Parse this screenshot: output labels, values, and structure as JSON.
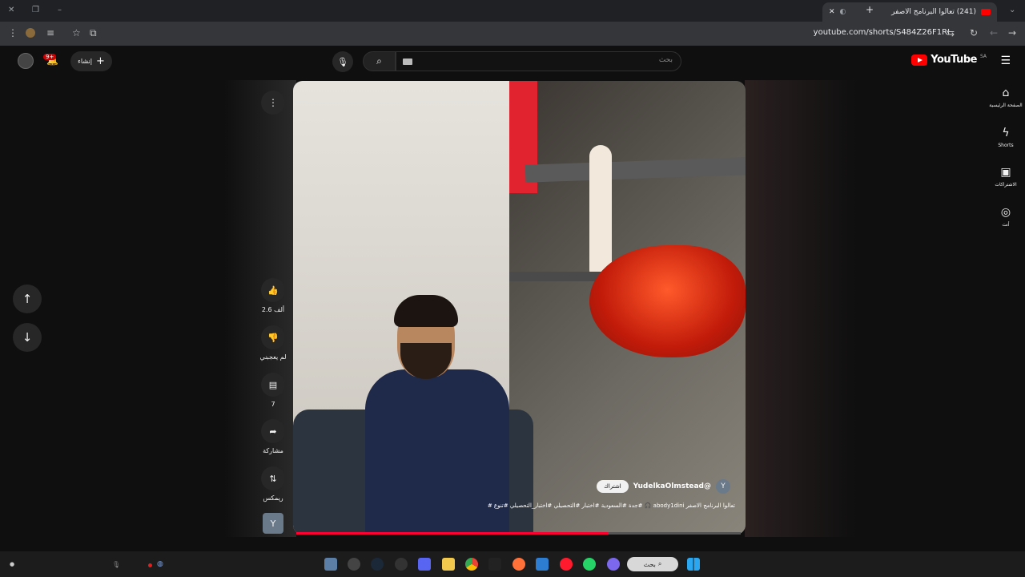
{
  "browser": {
    "tab_title": "(241) تعالوا البرنامج الاصفر",
    "url": "youtube.com/shorts/S484Z26F1RI"
  },
  "header": {
    "logo_text": "YouTube",
    "region": "SA",
    "search_placeholder": "بحث",
    "create_label": "إنشاء",
    "notification_count": "9+"
  },
  "sidebar": {
    "items": [
      {
        "label": "الصفحة الرئيسية",
        "icon": "home-icon"
      },
      {
        "label": "Shorts",
        "icon": "shorts-icon"
      },
      {
        "label": "الاشتراكات",
        "icon": "subscriptions-icon"
      },
      {
        "label": "أنت",
        "icon": "you-icon"
      }
    ]
  },
  "video": {
    "channel_handle": "@YudelkaOlmstead",
    "channel_initial": "Y",
    "subscribe_label": "اشتراك",
    "description": "تعالوا البرنامج الاصفر abody1dini 🎧 #جدة #السعودية #اختبار #التحصيلي #اختبار_التحصيلي #تنوع #",
    "progress": 0.7
  },
  "actions": {
    "like_count": "2.6 ألف",
    "dislike_label": "لم يعجبني",
    "comment_count": "7",
    "share_label": "مشاركة",
    "remix_label": "ريمكس"
  },
  "taskbar": {
    "search_label": "بحث"
  },
  "colors": {
    "accent": "#ff0033",
    "background": "#0f0f0f"
  }
}
